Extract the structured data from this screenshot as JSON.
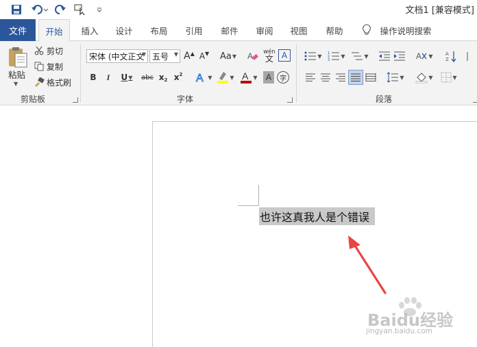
{
  "window": {
    "title": "文档1 [兼容模式]"
  },
  "quick_access": {
    "icons": [
      "save-icon",
      "undo-icon",
      "redo-icon",
      "touch-mode-icon",
      "customize-icon"
    ]
  },
  "tabs": {
    "file": "文件",
    "items": [
      "开始",
      "插入",
      "设计",
      "布局",
      "引用",
      "邮件",
      "审阅",
      "视图",
      "帮助"
    ],
    "active": "开始",
    "tell_me": "操作说明搜索"
  },
  "clipboard": {
    "paste": "粘贴",
    "cut": "剪切",
    "copy": "复制",
    "format_painter": "格式刷",
    "group_label": "剪贴板"
  },
  "font": {
    "font_name": "宋体 (中文正文",
    "font_size": "五号",
    "grow": "A",
    "shrink": "A",
    "change_case": "Aa",
    "bold": "B",
    "italic": "I",
    "underline": "U",
    "strike": "abc",
    "subscript": "x",
    "superscript": "x",
    "wen_label": "wén",
    "char_border": "A",
    "group_label": "字体"
  },
  "paragraph": {
    "group_label": "段落"
  },
  "document": {
    "selected_text": "也许这真我人是个错误"
  },
  "watermark": {
    "brand": "Baidu经验",
    "url": "jingyan.baidu.com"
  },
  "colors": {
    "accent": "#2b579a",
    "highlight_yellow": "#ffff00",
    "font_red": "#c00000",
    "annotation_arrow": "#e84545",
    "selection": "#c9c9c9"
  }
}
